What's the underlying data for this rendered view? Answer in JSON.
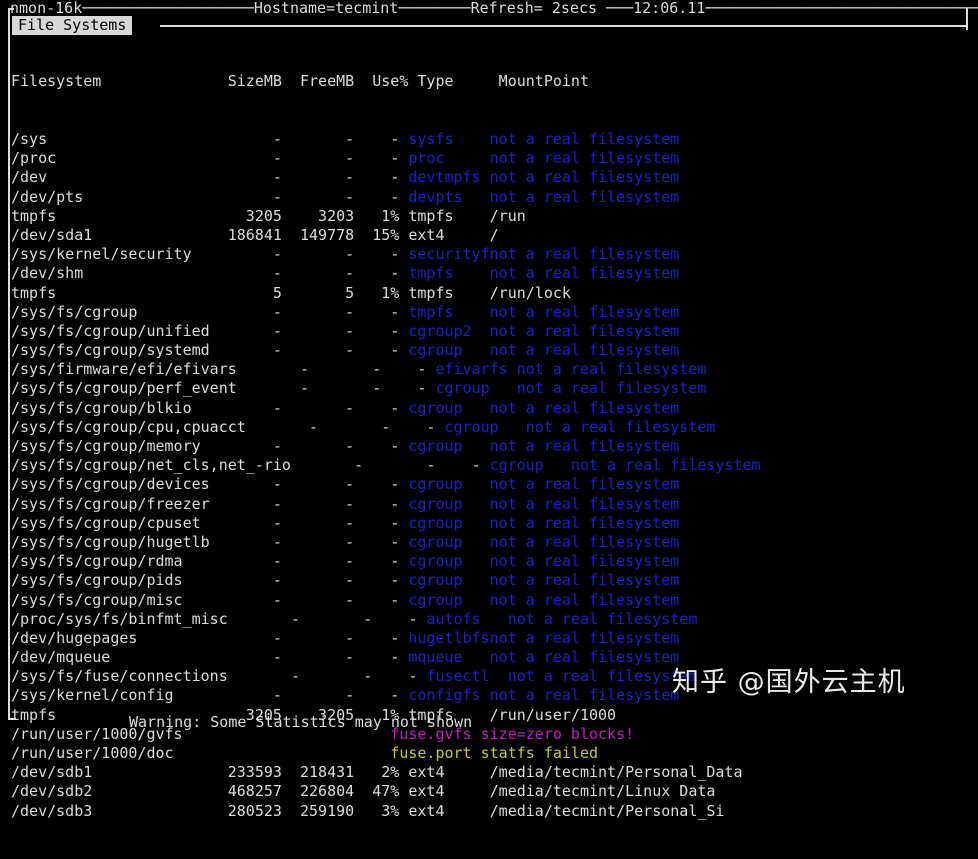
{
  "header": {
    "app_title": "nmon-16k",
    "hostname_label": "Hostname=tecmint",
    "refresh_label": "Refresh= 2secs",
    "clock": "12:06.11",
    "top_line": "nmon-16k───────────────────Hostname=tecmint────────Refresh= 2secs ───12:06.11──────────────────────────────────────────────────────────────"
  },
  "panel": {
    "tab_label": "File Systems",
    "columns": [
      "Filesystem",
      "SizeMB",
      "FreeMB",
      "Use%",
      "Type",
      "MountPoint"
    ],
    "header_line": "Filesystem              SizeMB  FreeMB  Use% Type     MountPoint"
  },
  "rows": [
    {
      "name": "/sys",
      "size": "-",
      "free": "-",
      "use": "-",
      "type": "sysfs",
      "mount": "not a real filesystem",
      "kind": "pseudo"
    },
    {
      "name": "/proc",
      "size": "-",
      "free": "-",
      "use": "-",
      "type": "proc",
      "mount": "not a real filesystem",
      "kind": "pseudo"
    },
    {
      "name": "/dev",
      "size": "-",
      "free": "-",
      "use": "-",
      "type": "devtmpfs",
      "mount": "not a real filesystem",
      "kind": "pseudo"
    },
    {
      "name": "/dev/pts",
      "size": "-",
      "free": "-",
      "use": "-",
      "type": "devpts",
      "mount": "not a real filesystem",
      "kind": "pseudo"
    },
    {
      "name": "tmpfs",
      "size": "3205",
      "free": "3203",
      "free_pad": "",
      "use": "1%",
      "type": "tmpfs",
      "mount": "/run",
      "kind": "real"
    },
    {
      "name": "/dev/sda1",
      "size": "186841",
      "free": "149778",
      "use": "15%",
      "type": "ext4",
      "mount": "/",
      "kind": "real"
    },
    {
      "name": "/sys/kernel/security",
      "size": "-",
      "free": "-",
      "use": "-",
      "type": "securityf",
      "mount": "not a real filesystem",
      "kind": "pseudo"
    },
    {
      "name": "/dev/shm",
      "size": "-",
      "free": "-",
      "use": "-",
      "type": "tmpfs",
      "mount": "not a real filesystem",
      "kind": "pseudo"
    },
    {
      "name": "tmpfs",
      "size": "5",
      "free": "5",
      "use": "1%",
      "type": "tmpfs",
      "mount": "/run/lock",
      "kind": "real"
    },
    {
      "name": "/sys/fs/cgroup",
      "size": "-",
      "free": "-",
      "use": "-",
      "type": "tmpfs",
      "mount": "not a real filesystem",
      "kind": "pseudo"
    },
    {
      "name": "/sys/fs/cgroup/unified",
      "size": "-",
      "free": "-",
      "use": "-",
      "type": "cgroup2",
      "mount": "not a real filesystem",
      "kind": "pseudo"
    },
    {
      "name": "/sys/fs/cgroup/systemd",
      "size": "-",
      "free": "-",
      "use": "-",
      "type": "cgroup",
      "mount": "not a real filesystem",
      "kind": "pseudo"
    },
    {
      "name": "/sys/firmware/efi/efivars",
      "size": "-",
      "free": "-",
      "use": "-",
      "type": "efivarfs",
      "mount": "not a real filesystem",
      "kind": "pseudo"
    },
    {
      "name": "/sys/fs/cgroup/perf_event",
      "size": "-",
      "free": "-",
      "use": "-",
      "type": "cgroup",
      "mount": "not a real filesystem",
      "kind": "pseudo"
    },
    {
      "name": "/sys/fs/cgroup/blkio",
      "size": "-",
      "free": "-",
      "use": "-",
      "type": "cgroup",
      "mount": "not a real filesystem",
      "kind": "pseudo"
    },
    {
      "name": "/sys/fs/cgroup/cpu,cpuacct",
      "size": "-",
      "free": "-",
      "use": "-",
      "type": "cgroup",
      "mount": "not a real filesystem",
      "kind": "pseudo"
    },
    {
      "name": "/sys/fs/cgroup/memory",
      "size": "-",
      "free": "-",
      "use": "-",
      "type": "cgroup",
      "mount": "not a real filesystem",
      "kind": "pseudo"
    },
    {
      "name": "/sys/fs/cgroup/net_cls,net_-rio",
      "size": "-",
      "free": "-",
      "use": "-",
      "type": "cgroup",
      "mount": "not a real filesystem",
      "kind": "pseudo"
    },
    {
      "name": "/sys/fs/cgroup/devices",
      "size": "-",
      "free": "-",
      "use": "-",
      "type": "cgroup",
      "mount": "not a real filesystem",
      "kind": "pseudo"
    },
    {
      "name": "/sys/fs/cgroup/freezer",
      "size": "-",
      "free": "-",
      "use": "-",
      "type": "cgroup",
      "mount": "not a real filesystem",
      "kind": "pseudo"
    },
    {
      "name": "/sys/fs/cgroup/cpuset",
      "size": "-",
      "free": "-",
      "use": "-",
      "type": "cgroup",
      "mount": "not a real filesystem",
      "kind": "pseudo"
    },
    {
      "name": "/sys/fs/cgroup/hugetlb",
      "size": "-",
      "free": "-",
      "use": "-",
      "type": "cgroup",
      "mount": "not a real filesystem",
      "kind": "pseudo"
    },
    {
      "name": "/sys/fs/cgroup/rdma",
      "size": "-",
      "free": "-",
      "use": "-",
      "type": "cgroup",
      "mount": "not a real filesystem",
      "kind": "pseudo"
    },
    {
      "name": "/sys/fs/cgroup/pids",
      "size": "-",
      "free": "-",
      "use": "-",
      "type": "cgroup",
      "mount": "not a real filesystem",
      "kind": "pseudo"
    },
    {
      "name": "/sys/fs/cgroup/misc",
      "size": "-",
      "free": "-",
      "use": "-",
      "type": "cgroup",
      "mount": "not a real filesystem",
      "kind": "pseudo"
    },
    {
      "name": "/proc/sys/fs/binfmt_misc",
      "size": "-",
      "free": "-",
      "use": "-",
      "type": "autofs",
      "mount": "not a real filesystem",
      "kind": "pseudo"
    },
    {
      "name": "/dev/hugepages",
      "size": "-",
      "free": "-",
      "use": "-",
      "type": "hugetlbfs",
      "mount": "not a real filesystem",
      "kind": "pseudo"
    },
    {
      "name": "/dev/mqueue",
      "size": "-",
      "free": "-",
      "use": "-",
      "type": "mqueue",
      "mount": "not a real filesystem",
      "kind": "pseudo"
    },
    {
      "name": "/sys/fs/fuse/connections",
      "size": "-",
      "free": "-",
      "use": "-",
      "type": "fusectl",
      "mount": "not a real filesystem",
      "kind": "pseudo"
    },
    {
      "name": "/sys/kernel/config",
      "size": "-",
      "free": "-",
      "use": "-",
      "type": "configfs",
      "mount": "not a real filesystem",
      "kind": "pseudo"
    },
    {
      "name": "tmpfs",
      "size": "3205",
      "free": "3205",
      "use": "1%",
      "type": "tmpfs",
      "mount": "/run/user/1000",
      "kind": "real"
    },
    {
      "name": "/run/user/1000/gvfs",
      "size": "",
      "free": "",
      "use": "",
      "type": "fuse.gvfs",
      "mount": "size=zero blocks!",
      "kind": "magenta"
    },
    {
      "name": "/run/user/1000/doc",
      "size": "",
      "free": "",
      "use": "",
      "type": "fuse.port",
      "mount": "statfs failed",
      "kind": "yellow"
    },
    {
      "name": "/dev/sdb1",
      "size": "233593",
      "free": "218431",
      "use": "2%",
      "type": "ext4",
      "mount": "/media/tecmint/Personal_Data",
      "kind": "real"
    },
    {
      "name": "/dev/sdb2",
      "size": "468257",
      "free": "226804",
      "use": "47%",
      "type": "ext4",
      "mount": "/media/tecmint/Linux Data",
      "kind": "real"
    },
    {
      "name": "/dev/sdb3",
      "size": "280523",
      "free": "259190",
      "use": "3%",
      "type": "ext4",
      "mount": "/media/tecmint/Personal_Si",
      "kind": "real"
    }
  ],
  "footer": {
    "warning": "Warning: Some Statistics may not shown"
  },
  "watermark": {
    "text": "知乎 @国外云主机"
  },
  "colors": {
    "background": "#000000",
    "foreground": "#dcdcdc",
    "pseudo_fs": "#2020c8",
    "warn_magenta": "#c020c0",
    "warn_yellow": "#c8c840",
    "tab_background": "#d8d8d8",
    "tab_foreground": "#000000"
  }
}
